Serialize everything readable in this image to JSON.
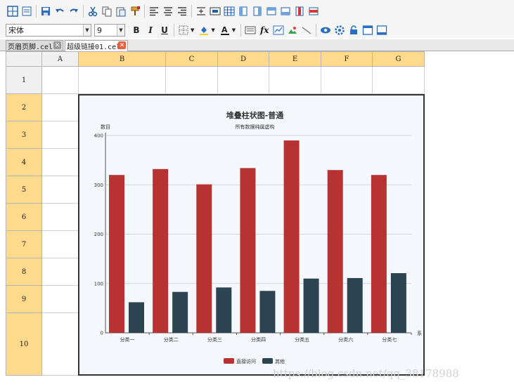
{
  "toolbar1": {
    "icons": [
      "insert-cell-icon",
      "preview-icon",
      "save-icon",
      "undo-icon",
      "redo-icon",
      "cut-icon",
      "copy-icon",
      "paste-icon",
      "format-painter-icon",
      "align-left-icon",
      "align-center-icon",
      "align-right-icon",
      "merge-cells-icon",
      "merge-center-icon",
      "table-icon",
      "insert-column-left-icon",
      "insert-column-right-icon",
      "insert-row-above-icon",
      "insert-row-below-icon",
      "delete-column-icon",
      "delete-row-icon"
    ]
  },
  "toolbar2": {
    "font_name": "宋体",
    "font_size": "9",
    "bold_label": "B",
    "italic_label": "I",
    "underline_label": "U",
    "formula_label": "fx",
    "icons": [
      "border-icon",
      "fill-color-icon",
      "font-color-icon",
      "text-wrap-icon",
      "formula-icon",
      "chart-icon",
      "image-icon",
      "slash-icon",
      "view-icon",
      "settings-icon",
      "lock-icon",
      "window-icon",
      "panel-icon"
    ]
  },
  "tabs": [
    {
      "label": "页眉页脚.cel",
      "active": false
    },
    {
      "label": "超级链接01.cel",
      "active": true
    }
  ],
  "grid": {
    "columns": [
      "A",
      "B",
      "C",
      "D",
      "E",
      "F",
      "G"
    ],
    "rows": [
      "1",
      "2",
      "3",
      "4",
      "5",
      "6",
      "7",
      "8",
      "9",
      "10"
    ],
    "header_color": "#ffd98c",
    "selected_columns": [
      "B",
      "C",
      "D",
      "E",
      "F",
      "G"
    ],
    "selected_rows": [
      "2",
      "3",
      "4",
      "5",
      "6",
      "7",
      "8",
      "9",
      "10"
    ]
  },
  "chart_data": {
    "type": "bar",
    "title": "堆叠柱状图-普通",
    "subtitle": "所有数据纯属虚构",
    "ylabel": "数目",
    "xlabel": "系",
    "ylim": [
      0,
      400
    ],
    "yticks": [
      0,
      100,
      200,
      300,
      400
    ],
    "categories": [
      "分类一",
      "分类二",
      "分类三",
      "分类四",
      "分类五",
      "分类六",
      "分类七"
    ],
    "series": [
      {
        "name": "直接访问",
        "color": "#b83232",
        "values": [
          320,
          332,
          301,
          334,
          390,
          330,
          320
        ]
      },
      {
        "name": "其他",
        "color": "#2c4352",
        "values": [
          62,
          83,
          92,
          85,
          110,
          111,
          121
        ]
      }
    ],
    "grid": true,
    "legend_position": "bottom-center"
  },
  "watermark": "https://blog.csdn.net/qq_38178988"
}
